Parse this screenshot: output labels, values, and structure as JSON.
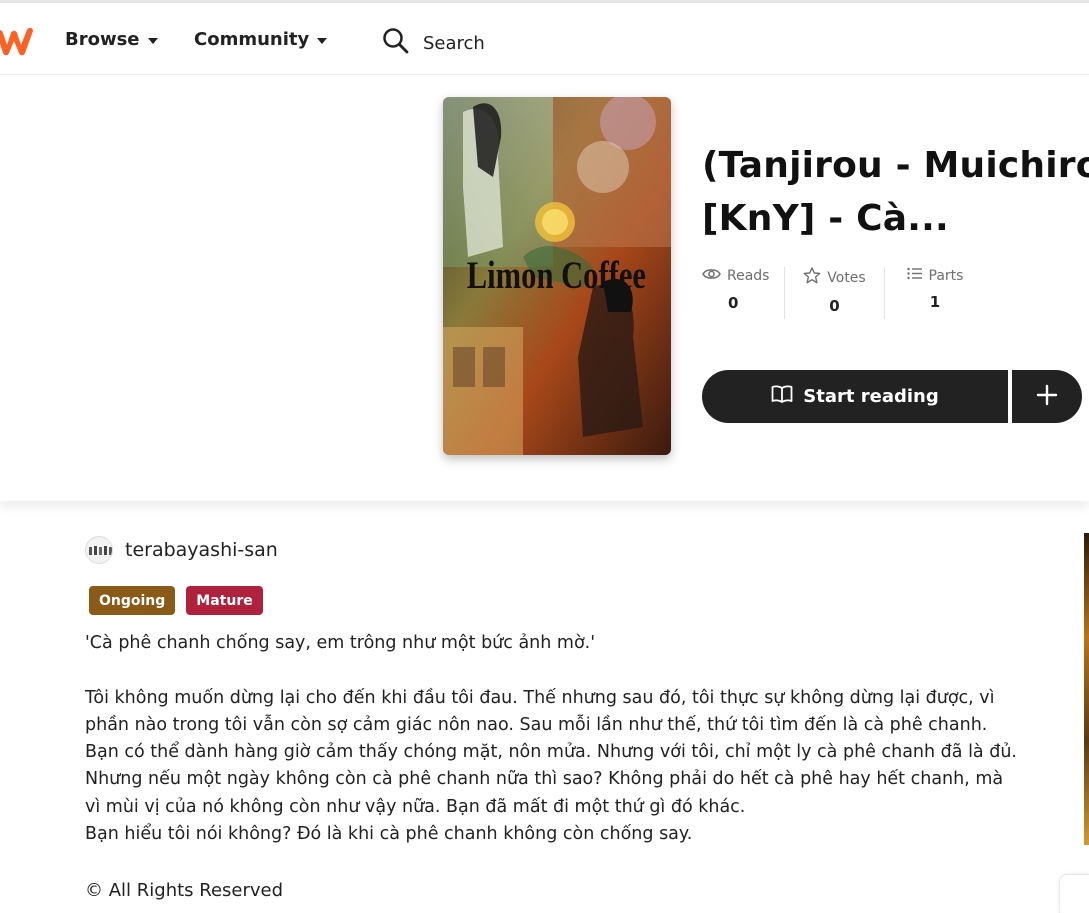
{
  "nav": {
    "logo_icon": "wattpad-w-logo",
    "browse_label": "Browse",
    "community_label": "Community",
    "search_label": "Search",
    "brand_color": "#ff6122"
  },
  "story": {
    "cover_text": "Limon Coffee",
    "title_line1": "(Tanjirou - Muichirou)",
    "title_line2": "[KnY] - Cà...",
    "stats": {
      "reads_label": "Reads",
      "reads_value": "0",
      "votes_label": "Votes",
      "votes_value": "0",
      "parts_label": "Parts",
      "parts_value": "1"
    },
    "start_reading_label": "Start reading",
    "add_icon": "plus-icon"
  },
  "author": {
    "name": "terabayashi-san"
  },
  "badges": {
    "ongoing": "Ongoing",
    "mature": "Mature",
    "ongoing_color": "#8a5a17",
    "mature_color": "#b0213d"
  },
  "description": {
    "line1": "'Cà phê chanh chống say, em trông như một bức ảnh mờ.'",
    "line2": "Tôi không muốn dừng lại cho đến khi đầu tôi đau. Thế nhưng sau đó, tôi thực sự không dừng lại được, vì",
    "line3": "phần nào trong tôi vẫn còn sợ cảm giác nôn nao. Sau mỗi lần như thế, thứ tôi tìm đến là cà phê chanh.",
    "line4": "Bạn có thể dành hàng giờ cảm thấy chóng mặt, nôn mửa. Nhưng với tôi, chỉ một ly cà phê chanh đã là đủ.",
    "line5": "Nhưng nếu một ngày không còn cà phê chanh nữa thì sao? Không phải do hết cà phê hay hết chanh, mà",
    "line6": "vì mùi vị của nó không còn như vậy nữa. Bạn đã mất đi một thứ gì đó khác.",
    "line7": "Bạn hiểu tôi nói không? Đó là khi cà phê chanh không còn chống say."
  },
  "copyright": "© All Rights Reserved"
}
